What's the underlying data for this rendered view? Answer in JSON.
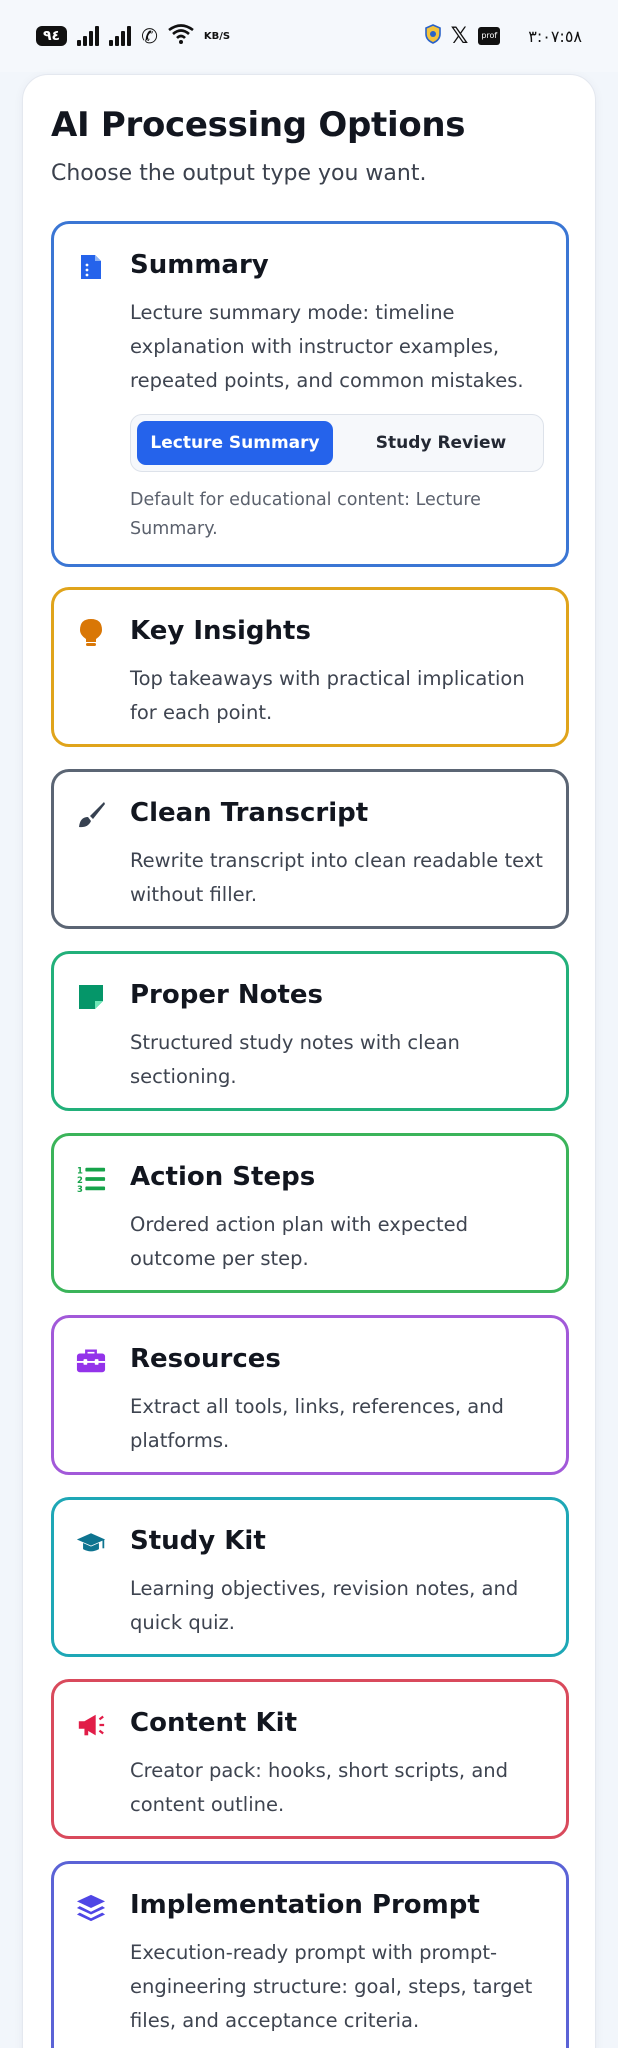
{
  "status_bar": {
    "battery": "٩٤",
    "speed_value": "KB/S",
    "x_logo": "𝕏",
    "app_badge": "prof",
    "time": "٣:٠٧:٥٨"
  },
  "header": {
    "title": "AI Processing Options",
    "subtitle": "Choose the output type you want."
  },
  "options": [
    {
      "title": "Summary",
      "icon": "document-icon",
      "color": "#3b76d4",
      "description": "Lecture summary mode: timeline explanation with instructor examples, repeated points, and common mistakes.",
      "modes": [
        "Lecture Summary",
        "Study Review"
      ],
      "selected_mode": "Lecture Summary",
      "note": "Default for educational content: Lecture Summary."
    },
    {
      "title": "Key Insights",
      "icon": "lightbulb-icon",
      "color": "#e0a41b",
      "description": "Top takeaways with practical implication for each point."
    },
    {
      "title": "Clean Transcript",
      "icon": "brush-icon",
      "color": "#5b6574",
      "description": "Rewrite transcript into clean readable text without filler."
    },
    {
      "title": "Proper Notes",
      "icon": "sticky-note-icon",
      "color": "#22b07a",
      "description": "Structured study notes with clean sectioning."
    },
    {
      "title": "Action Steps",
      "icon": "numbered-list-icon",
      "color": "#3bb45a",
      "description": "Ordered action plan with expected outcome per step."
    },
    {
      "title": "Resources",
      "icon": "toolbox-icon",
      "color": "#a259d9",
      "description": "Extract all tools, links, references, and platforms."
    },
    {
      "title": "Study Kit",
      "icon": "graduation-cap-icon",
      "color": "#1ea7b6",
      "description": "Learning objectives, revision notes, and quick quiz."
    },
    {
      "title": "Content Kit",
      "icon": "megaphone-icon",
      "color": "#d94a5c",
      "description": "Creator pack: hooks, short scripts, and content outline."
    },
    {
      "title": "Implementation Prompt",
      "icon": "layers-icon",
      "color": "#5b63d6",
      "description": "Execution-ready prompt with prompt-engineering structure: goal, steps, target files, and acceptance criteria."
    }
  ]
}
